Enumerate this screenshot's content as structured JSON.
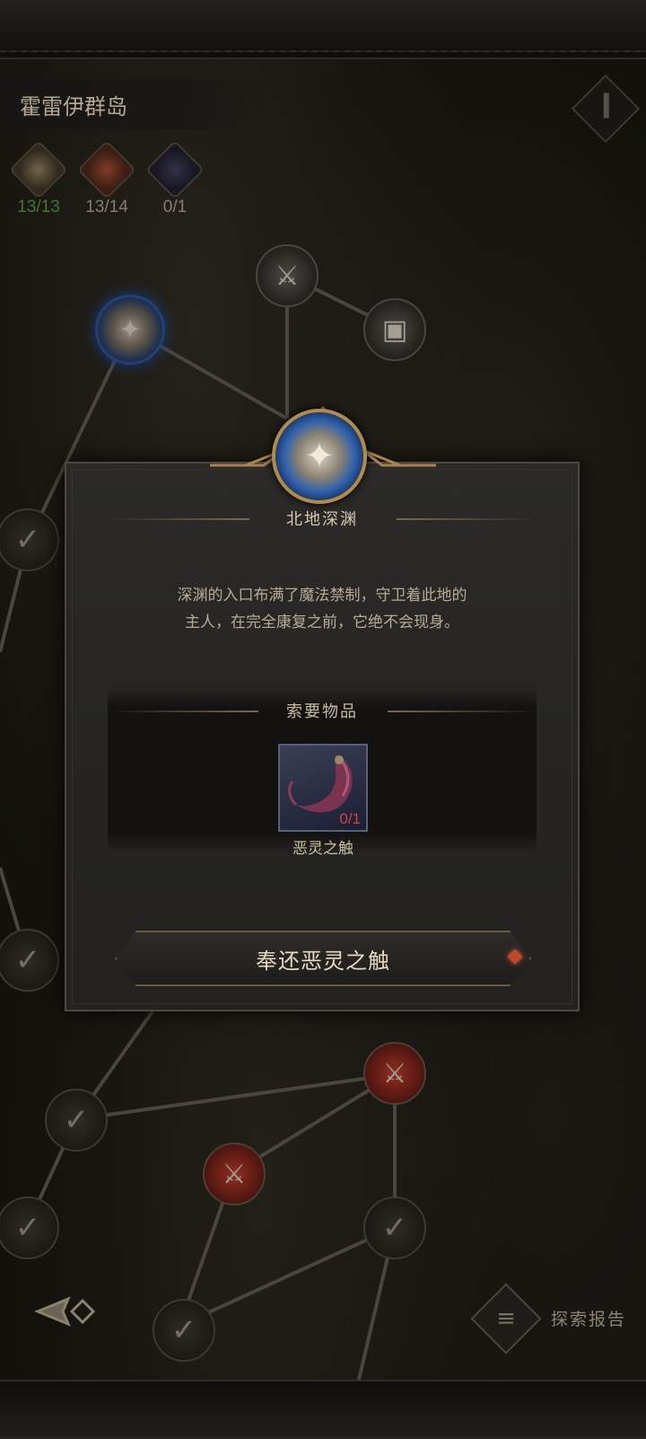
{
  "region": {
    "title": "霍雷伊群岛"
  },
  "stats": [
    {
      "icon": "treasure-chest-icon",
      "count": "13/13"
    },
    {
      "icon": "red-chest-icon",
      "count": "13/14"
    },
    {
      "icon": "dark-chest-icon",
      "count": "0/1"
    }
  ],
  "dialog": {
    "title": "北地深渊",
    "description_line1": "深渊的入口布满了魔法禁制，守卫着此地的",
    "description_line2": "主人，在完全康复之前，它绝不会现身。",
    "required_title": "索要物品",
    "item": {
      "name": "恶灵之触",
      "count": "0/1",
      "icon": "tentacle-icon"
    },
    "action_label": "奉还恶灵之触"
  },
  "footer": {
    "report_label": "探索报告"
  }
}
